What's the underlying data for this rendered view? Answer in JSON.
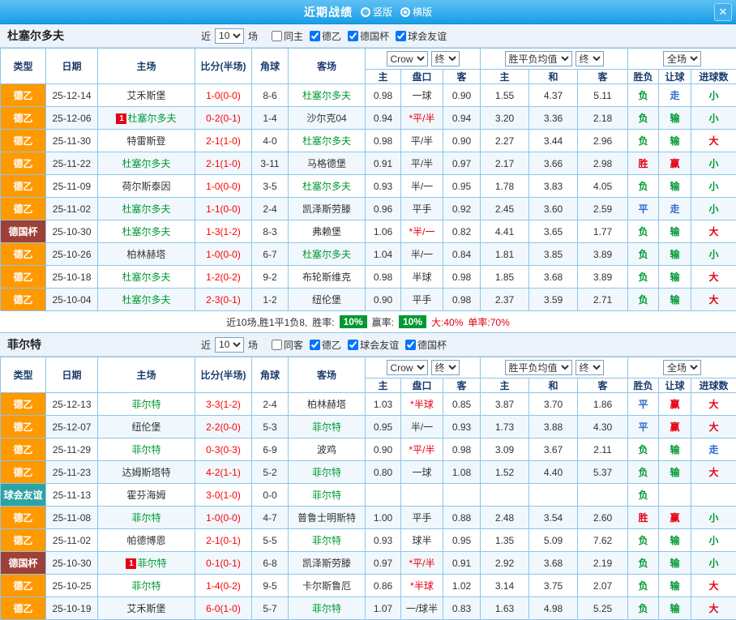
{
  "titlebar": {
    "title": "近期战绩",
    "layout_options": [
      {
        "label": "竖版",
        "selected": false
      },
      {
        "label": "横版",
        "selected": true
      }
    ],
    "close_label": "✕"
  },
  "colors": {
    "type_colors": {
      "德乙": "#ff9900",
      "德国杯": "#9e4036",
      "球会友谊": "#2fa3a3"
    },
    "win_color": "#e60012",
    "lose_color": "#009933",
    "draw_color": "#2b6bd0",
    "score_color": "#ff0000",
    "rate_badge_bg": "#009933",
    "grid_color": "#8cc6e9"
  },
  "table_headers": {
    "col1": [
      "类型",
      "日期",
      "主场",
      "比分(半场)",
      "角球",
      "客场"
    ],
    "odds_group": {
      "bookmaker": "Crow",
      "time": "终"
    },
    "europe_group": {
      "metric": "胜平负均值",
      "time": "终"
    },
    "result_group": {
      "period": "全场"
    },
    "col2": [
      "主",
      "盘口",
      "客",
      "主",
      "和",
      "客",
      "胜负",
      "让球",
      "进球数"
    ]
  },
  "sections": [
    {
      "team": "杜塞尔多夫",
      "filter": {
        "near": "近",
        "count": "10",
        "unit": "场",
        "checkboxes": [
          {
            "label": "同主",
            "checked": false
          },
          {
            "label": "德乙",
            "checked": true
          },
          {
            "label": "德国杯",
            "checked": true
          },
          {
            "label": "球会友谊",
            "checked": true
          }
        ]
      },
      "rows": [
        {
          "type": "德乙",
          "date": "25-12-14",
          "home": "艾禾斯堡",
          "home_focus": false,
          "home_badge": "",
          "score": "1-0(0-0)",
          "corner": "8-6",
          "away": "杜塞尔多夫",
          "away_focus": true,
          "ah_home": "0.98",
          "ah_line": "一球",
          "ah_away": "0.90",
          "eu_home": "1.55",
          "eu_draw": "4.37",
          "eu_away": "5.11",
          "result": "负",
          "ah_result": "走",
          "goal_result": "小"
        },
        {
          "type": "德乙",
          "date": "25-12-06",
          "home": "杜塞尔多夫",
          "home_focus": true,
          "home_badge": "1",
          "score": "0-2(0-1)",
          "corner": "1-4",
          "away": "沙尔克04",
          "away_focus": false,
          "ah_home": "0.94",
          "ah_line": "*平/半",
          "ah_away": "0.94",
          "eu_home": "3.20",
          "eu_draw": "3.36",
          "eu_away": "2.18",
          "result": "负",
          "ah_result": "输",
          "goal_result": "小"
        },
        {
          "type": "德乙",
          "date": "25-11-30",
          "home": "特雷斯登",
          "home_focus": false,
          "home_badge": "",
          "score": "2-1(1-0)",
          "corner": "4-0",
          "away": "杜塞尔多夫",
          "away_focus": true,
          "ah_home": "0.98",
          "ah_line": "平/半",
          "ah_away": "0.90",
          "eu_home": "2.27",
          "eu_draw": "3.44",
          "eu_away": "2.96",
          "result": "负",
          "ah_result": "输",
          "goal_result": "大"
        },
        {
          "type": "德乙",
          "date": "25-11-22",
          "home": "杜塞尔多夫",
          "home_focus": true,
          "home_badge": "",
          "score": "2-1(1-0)",
          "corner": "3-11",
          "away": "马格德堡",
          "away_focus": false,
          "ah_home": "0.91",
          "ah_line": "平/半",
          "ah_away": "0.97",
          "eu_home": "2.17",
          "eu_draw": "3.66",
          "eu_away": "2.98",
          "result": "胜",
          "ah_result": "赢",
          "goal_result": "小"
        },
        {
          "type": "德乙",
          "date": "25-11-09",
          "home": "荷尔斯泰因",
          "home_focus": false,
          "home_badge": "",
          "score": "1-0(0-0)",
          "corner": "3-5",
          "away": "杜塞尔多夫",
          "away_focus": true,
          "ah_home": "0.93",
          "ah_line": "半/一",
          "ah_away": "0.95",
          "eu_home": "1.78",
          "eu_draw": "3.83",
          "eu_away": "4.05",
          "result": "负",
          "ah_result": "输",
          "goal_result": "小"
        },
        {
          "type": "德乙",
          "date": "25-11-02",
          "home": "杜塞尔多夫",
          "home_focus": true,
          "home_badge": "",
          "score": "1-1(0-0)",
          "corner": "2-4",
          "away": "凯泽斯劳滕",
          "away_focus": false,
          "ah_home": "0.96",
          "ah_line": "平手",
          "ah_away": "0.92",
          "eu_home": "2.45",
          "eu_draw": "3.60",
          "eu_away": "2.59",
          "result": "平",
          "ah_result": "走",
          "goal_result": "小"
        },
        {
          "type": "德国杯",
          "date": "25-10-30",
          "home": "杜塞尔多夫",
          "home_focus": true,
          "home_badge": "",
          "score": "1-3(1-2)",
          "corner": "8-3",
          "away": "弗赖堡",
          "away_focus": false,
          "ah_home": "1.06",
          "ah_line": "*半/一",
          "ah_away": "0.82",
          "eu_home": "4.41",
          "eu_draw": "3.65",
          "eu_away": "1.77",
          "result": "负",
          "ah_result": "输",
          "goal_result": "大"
        },
        {
          "type": "德乙",
          "date": "25-10-26",
          "home": "柏林赫塔",
          "home_focus": false,
          "home_badge": "",
          "score": "1-0(0-0)",
          "corner": "6-7",
          "away": "杜塞尔多夫",
          "away_focus": true,
          "ah_home": "1.04",
          "ah_line": "半/一",
          "ah_away": "0.84",
          "eu_home": "1.81",
          "eu_draw": "3.85",
          "eu_away": "3.89",
          "result": "负",
          "ah_result": "输",
          "goal_result": "小"
        },
        {
          "type": "德乙",
          "date": "25-10-18",
          "home": "杜塞尔多夫",
          "home_focus": true,
          "home_badge": "",
          "score": "1-2(0-2)",
          "corner": "9-2",
          "away": "布轮斯维克",
          "away_focus": false,
          "ah_home": "0.98",
          "ah_line": "半球",
          "ah_away": "0.98",
          "eu_home": "1.85",
          "eu_draw": "3.68",
          "eu_away": "3.89",
          "result": "负",
          "ah_result": "输",
          "goal_result": "大"
        },
        {
          "type": "德乙",
          "date": "25-10-04",
          "home": "杜塞尔多夫",
          "home_focus": true,
          "home_badge": "",
          "score": "2-3(0-1)",
          "corner": "1-2",
          "away": "纽伦堡",
          "away_focus": false,
          "ah_home": "0.90",
          "ah_line": "平手",
          "ah_away": "0.98",
          "eu_home": "2.37",
          "eu_draw": "3.59",
          "eu_away": "2.71",
          "result": "负",
          "ah_result": "输",
          "goal_result": "大"
        }
      ],
      "summary": {
        "record": "近10场,胜1平1负8,",
        "win_rate_label": "胜率:",
        "win_rate": "10%",
        "cover_rate_label": "赢率:",
        "cover_rate": "10%",
        "big_rate": "大:40%",
        "single_rate": "单率:70%"
      }
    },
    {
      "team": "菲尔特",
      "filter": {
        "near": "近",
        "count": "10",
        "unit": "场",
        "checkboxes": [
          {
            "label": "同客",
            "checked": false
          },
          {
            "label": "德乙",
            "checked": true
          },
          {
            "label": "球会友谊",
            "checked": true
          },
          {
            "label": "德国杯",
            "checked": true
          }
        ]
      },
      "rows": [
        {
          "type": "德乙",
          "date": "25-12-13",
          "home": "菲尔特",
          "home_focus": true,
          "home_badge": "",
          "score": "3-3(1-2)",
          "corner": "2-4",
          "away": "柏林赫塔",
          "away_focus": false,
          "ah_home": "1.03",
          "ah_line": "*半球",
          "ah_away": "0.85",
          "eu_home": "3.87",
          "eu_draw": "3.70",
          "eu_away": "1.86",
          "result": "平",
          "ah_result": "赢",
          "goal_result": "大"
        },
        {
          "type": "德乙",
          "date": "25-12-07",
          "home": "纽伦堡",
          "home_focus": false,
          "home_badge": "",
          "score": "2-2(0-0)",
          "corner": "5-3",
          "away": "菲尔特",
          "away_focus": true,
          "ah_home": "0.95",
          "ah_line": "半/一",
          "ah_away": "0.93",
          "eu_home": "1.73",
          "eu_draw": "3.88",
          "eu_away": "4.30",
          "result": "平",
          "ah_result": "赢",
          "goal_result": "大"
        },
        {
          "type": "德乙",
          "date": "25-11-29",
          "home": "菲尔特",
          "home_focus": true,
          "home_badge": "",
          "score": "0-3(0-3)",
          "corner": "6-9",
          "away": "波鸡",
          "away_focus": false,
          "ah_home": "0.90",
          "ah_line": "*平/半",
          "ah_away": "0.98",
          "eu_home": "3.09",
          "eu_draw": "3.67",
          "eu_away": "2.11",
          "result": "负",
          "ah_result": "输",
          "goal_result": "走"
        },
        {
          "type": "德乙",
          "date": "25-11-23",
          "home": "达姆斯塔特",
          "home_focus": false,
          "home_badge": "",
          "score": "4-2(1-1)",
          "corner": "5-2",
          "away": "菲尔特",
          "away_focus": true,
          "ah_home": "0.80",
          "ah_line": "一球",
          "ah_away": "1.08",
          "eu_home": "1.52",
          "eu_draw": "4.40",
          "eu_away": "5.37",
          "result": "负",
          "ah_result": "输",
          "goal_result": "大"
        },
        {
          "type": "球会友谊",
          "date": "25-11-13",
          "home": "霍芬海姆",
          "home_focus": false,
          "home_badge": "",
          "score": "3-0(1-0)",
          "corner": "0-0",
          "away": "菲尔特",
          "away_focus": true,
          "ah_home": "",
          "ah_line": "",
          "ah_away": "",
          "eu_home": "",
          "eu_draw": "",
          "eu_away": "",
          "result": "负",
          "ah_result": "",
          "goal_result": ""
        },
        {
          "type": "德乙",
          "date": "25-11-08",
          "home": "菲尔特",
          "home_focus": true,
          "home_badge": "",
          "score": "1-0(0-0)",
          "corner": "4-7",
          "away": "普鲁士明斯特",
          "away_focus": false,
          "ah_home": "1.00",
          "ah_line": "平手",
          "ah_away": "0.88",
          "eu_home": "2.48",
          "eu_draw": "3.54",
          "eu_away": "2.60",
          "result": "胜",
          "ah_result": "赢",
          "goal_result": "小"
        },
        {
          "type": "德乙",
          "date": "25-11-02",
          "home": "帕德博恩",
          "home_focus": false,
          "home_badge": "",
          "score": "2-1(0-1)",
          "corner": "5-5",
          "away": "菲尔特",
          "away_focus": true,
          "ah_home": "0.93",
          "ah_line": "球半",
          "ah_away": "0.95",
          "eu_home": "1.35",
          "eu_draw": "5.09",
          "eu_away": "7.62",
          "result": "负",
          "ah_result": "输",
          "goal_result": "小"
        },
        {
          "type": "德国杯",
          "date": "25-10-30",
          "home": "菲尔特",
          "home_focus": true,
          "home_badge": "1",
          "score": "0-1(0-1)",
          "corner": "6-8",
          "away": "凯泽斯劳滕",
          "away_focus": false,
          "ah_home": "0.97",
          "ah_line": "*平/半",
          "ah_away": "0.91",
          "eu_home": "2.92",
          "eu_draw": "3.68",
          "eu_away": "2.19",
          "result": "负",
          "ah_result": "输",
          "goal_result": "小"
        },
        {
          "type": "德乙",
          "date": "25-10-25",
          "home": "菲尔特",
          "home_focus": true,
          "home_badge": "",
          "score": "1-4(0-2)",
          "corner": "9-5",
          "away": "卡尔斯鲁厄",
          "away_focus": false,
          "ah_home": "0.86",
          "ah_line": "*半球",
          "ah_away": "1.02",
          "eu_home": "3.14",
          "eu_draw": "3.75",
          "eu_away": "2.07",
          "result": "负",
          "ah_result": "输",
          "goal_result": "大"
        },
        {
          "type": "德乙",
          "date": "25-10-19",
          "home": "艾禾斯堡",
          "home_focus": false,
          "home_badge": "",
          "score": "6-0(1-0)",
          "corner": "5-7",
          "away": "菲尔特",
          "away_focus": true,
          "ah_home": "1.07",
          "ah_line": "一/球半",
          "ah_away": "0.83",
          "eu_home": "1.63",
          "eu_draw": "4.98",
          "eu_away": "5.25",
          "result": "负",
          "ah_result": "输",
          "goal_result": "大"
        }
      ],
      "summary": null
    }
  ]
}
